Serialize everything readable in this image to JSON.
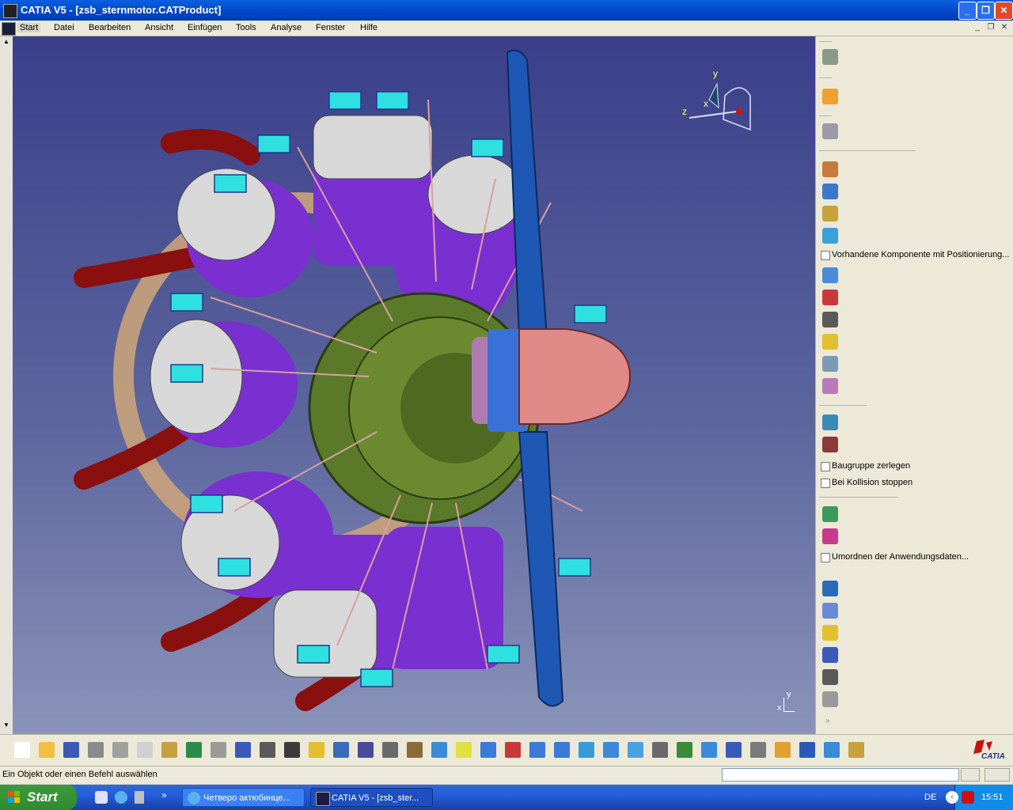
{
  "window": {
    "title": "CATIA V5 - [zsb_sternmotor.CATProduct]",
    "minimize": "_",
    "maximize": "❐",
    "close": "✕"
  },
  "menu": {
    "items": [
      "Start",
      "Datei",
      "Bearbeiten",
      "Ansicht",
      "Einfügen",
      "Tools",
      "Analyse",
      "Fenster",
      "Hilfe"
    ]
  },
  "viewport": {
    "compass_axes": {
      "x": "x",
      "y": "y",
      "z": "z"
    },
    "axis_triad": {
      "x": "x",
      "y": "y"
    }
  },
  "right_toolbar": {
    "checkboxes": [
      {
        "label": "Vorhandene Komponente mit Positionierung...",
        "checked": false
      },
      {
        "label": "Baugruppe zerlegen",
        "checked": false
      },
      {
        "label": "Bei Kollision stoppen",
        "checked": false
      },
      {
        "label": "Umordnen der Anwendungsdaten...",
        "checked": false
      }
    ]
  },
  "bottom_toolbar": {
    "icons": [
      "new-icon",
      "open-icon",
      "save-icon",
      "print-icon",
      "cut-icon",
      "copy-icon",
      "paste-icon",
      "undo-icon",
      "redo-icon",
      "help-icon",
      "formula-icon",
      "knowledge-icon",
      "parameter-icon",
      "table-icon",
      "tree-icon",
      "lock-icon",
      "catalog-icon",
      "fly-icon",
      "fit-all-icon",
      "pan-icon",
      "rotate-icon",
      "zoom-in-icon",
      "zoom-out-icon",
      "normal-view-icon",
      "multi-view-icon",
      "iso-view-icon",
      "shading-icon",
      "hide-show-icon",
      "swap-icon",
      "measure-icon",
      "snap-icon",
      "compass-icon",
      "light-icon",
      "cube-icon",
      "explode-icon"
    ],
    "brand": "CATIA"
  },
  "status": {
    "message": "Ein Objekt oder einen Befehl auswählen"
  },
  "taskbar": {
    "start": "Start",
    "tasks": [
      {
        "label": "Четверо актюбинце...",
        "icon": "ie-icon"
      },
      {
        "label": "CATIA V5 - [zsb_ster...",
        "icon": "catia-icon"
      }
    ],
    "lang": "DE",
    "clock": "15:51"
  }
}
